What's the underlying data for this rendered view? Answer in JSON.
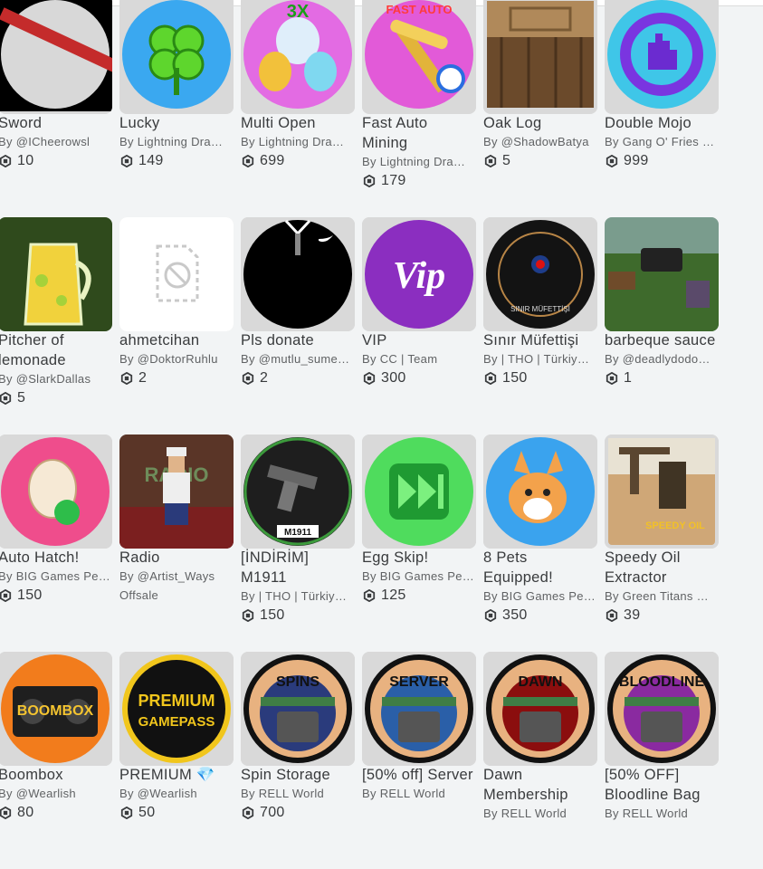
{
  "rows": [
    [
      {
        "title": "Sword",
        "creator": "@ICheerowsl",
        "price": "10",
        "icon": "sword-icon",
        "bg": "#c9c9c9"
      },
      {
        "title": "Lucky",
        "creator": "Lightning Dra…",
        "price": "149",
        "icon": "clover-icon",
        "bg": "#4fb3f0"
      },
      {
        "title": "Multi Open",
        "creator": "Lightning Dra…",
        "price": "699",
        "icon": "eggs-icon",
        "bg": "#d45fe0"
      },
      {
        "title": "Fast Auto Mining",
        "creator": "Lightning Dra…",
        "price": "179",
        "icon": "pickaxe-icon",
        "bg": "#e259d8"
      },
      {
        "title": "Oak Log",
        "creator": "@ShadowBatya",
        "price": "5",
        "icon": "log-icon",
        "bg": "#7a5a34"
      },
      {
        "title": "Double Mojo",
        "creator": "Gang O' Fries …",
        "price": "999",
        "icon": "hand-icon",
        "bg": "#37c4e4"
      }
    ],
    [
      {
        "title": "Pitcher of lemonade",
        "creator": "@SlarkDallas",
        "price": "5",
        "icon": "pitcher-icon",
        "bg": "#3a5522"
      },
      {
        "title": "ahmetcihan",
        "creator": "@DoktorRuhlu",
        "price": "2",
        "icon": "blocked-file-icon",
        "bg": "#ffffff"
      },
      {
        "title": "Pls donate",
        "creator": "@mutlu_sume…",
        "price": "2",
        "icon": "shirt-icon",
        "bg": "#000000"
      },
      {
        "title": "VIP",
        "creator": "CC | Team",
        "price": "300",
        "icon": "vip-icon",
        "bg": "#7b2ba8"
      },
      {
        "title": "Sınır Müfettişi",
        "creator": "| THO | Türkiy…",
        "price": "150",
        "icon": "badge-icon",
        "bg": "#1c1c1c"
      },
      {
        "title": "barbeque sauce",
        "creator": "@deadlydodo…",
        "price": "1",
        "icon": "game-scene-icon",
        "bg": "#466b3d"
      }
    ],
    [
      {
        "title": "Auto Hatch!",
        "creator": "BIG Games Pe…",
        "price": "150",
        "icon": "egg-icon",
        "bg": "#e8457f"
      },
      {
        "title": "Radio",
        "creator": "@Artist_Ways",
        "price": "",
        "offsale": "Offsale",
        "icon": "radio-avatar-icon",
        "bg": "#5a3527"
      },
      {
        "title": "[İNDİRİM] M1911",
        "creator": "| THO | Türkiy…",
        "price": "150",
        "icon": "pistol-icon",
        "bg": "#1d2a20"
      },
      {
        "title": "Egg Skip!",
        "creator": "BIG Games Pe…",
        "price": "125",
        "icon": "skip-icon",
        "bg": "#4ed85a"
      },
      {
        "title": "8 Pets Equipped!",
        "creator": "BIG Games Pe…",
        "price": "350",
        "icon": "corgi-icon",
        "bg": "#3aa3ee"
      },
      {
        "title": "Speedy Oil Extractor",
        "creator": "Green Titans …",
        "price": "39",
        "icon": "oil-pump-icon",
        "bg": "#c6a16e"
      }
    ],
    [
      {
        "title": "Boombox",
        "creator": "@Wearlish",
        "price": "80",
        "icon": "boombox-icon",
        "bg": "#f07e1c"
      },
      {
        "title": "PREMIUM 💎",
        "creator": "@Wearlish",
        "price": "50",
        "icon": "premium-icon",
        "bg": "#111111"
      },
      {
        "title": "Spin Storage",
        "creator": "RELL World",
        "price": "700",
        "icon": "spins-icon",
        "bg": "#242a6b"
      },
      {
        "title": "[50% off] Server",
        "creator": "RELL World",
        "price": "",
        "icon": "server-icon",
        "bg": "#1f4d8c"
      },
      {
        "title": "Dawn Membership",
        "creator": "RELL World",
        "price": "",
        "icon": "dawn-icon",
        "bg": "#7a0c0c"
      },
      {
        "title": "[50% OFF] Bloodline Bag",
        "creator": "RELL World",
        "price": "",
        "icon": "bloodline-icon",
        "bg": "#7d1a91"
      }
    ]
  ],
  "by_prefix": "By"
}
